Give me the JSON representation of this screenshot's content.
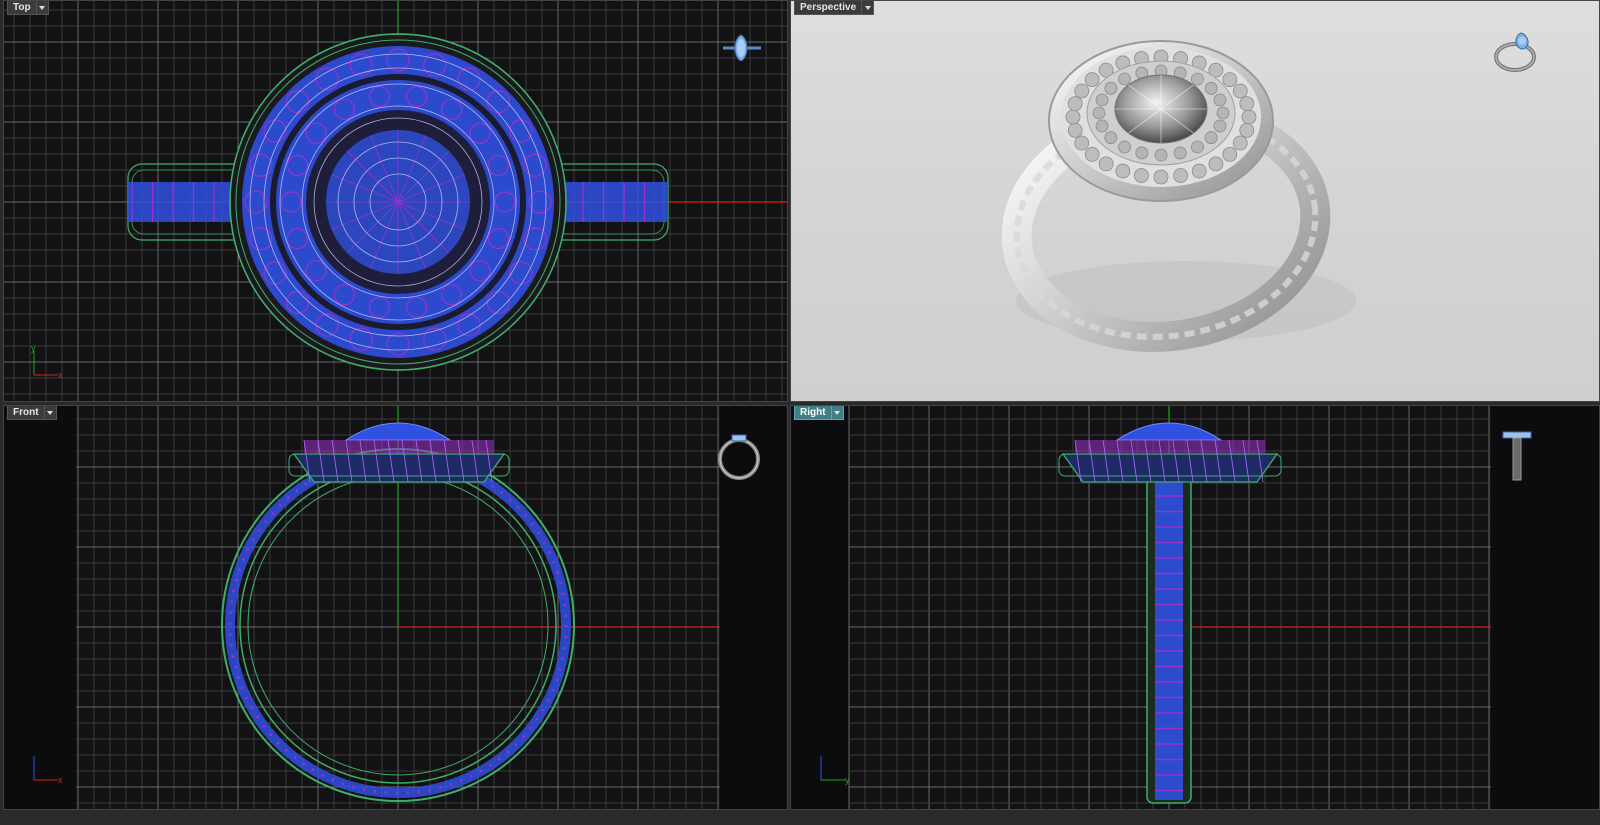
{
  "viewports": {
    "top": {
      "label": "Top"
    },
    "perspective": {
      "label": "Perspective"
    },
    "front": {
      "label": "Front"
    },
    "right": {
      "label": "Right"
    }
  },
  "axes": {
    "top": {
      "a": "x",
      "b": "y"
    },
    "front": {
      "a": "x",
      "b": "z"
    },
    "right": {
      "a": "y",
      "b": "z"
    }
  },
  "icons": {
    "top_nav": "pear-stone-navigation-icon",
    "perspective_nav": "ring-navigation-icon",
    "front_nav": "ring-side-navigation-icon",
    "right_nav": "ring-profile-navigation-icon",
    "dropdown": "chevron-down-icon"
  },
  "colors": {
    "viewport_bg": "#121214",
    "grid_minor": "#3a3a3a",
    "grid_major": "#6b6b6b",
    "x_axis": "#d42020",
    "y_axis": "#1fa31f",
    "wire_green": "#3fae6a",
    "wire_blue": "#2f50e0",
    "wire_purple": "#9a32c8",
    "active_tab": "#3f7f86",
    "perspective_bg": "#d8d8d8"
  }
}
